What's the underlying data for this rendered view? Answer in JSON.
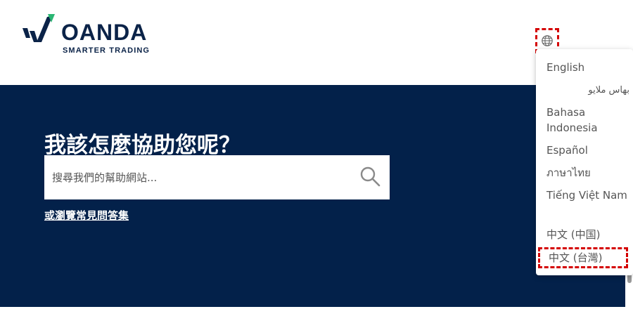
{
  "brand": {
    "name": "OANDA",
    "tagline": "SMARTER TRADING",
    "colors": {
      "navy": "#0b2348",
      "green": "#2bb673",
      "hero_bg": "#03214a"
    }
  },
  "header": {
    "language_button_icon": "globe-icon"
  },
  "hero": {
    "title": "我該怎麼協助您呢？",
    "search": {
      "placeholder": "搜尋我們的幫助網站...",
      "value": "",
      "icon": "search-icon"
    },
    "faq_link": "或瀏覽常見問答集"
  },
  "language_menu": {
    "items": [
      {
        "label": "English"
      },
      {
        "label": "بهاس ملايو"
      },
      {
        "label": "Bahasa Indonesia"
      },
      {
        "label": "Español"
      },
      {
        "label": "ภาษาไทย"
      },
      {
        "label": "Tiếng Việt Nam"
      },
      {
        "label": "中文 (中国)"
      },
      {
        "label": "中文 (台灣)"
      }
    ],
    "highlighted_color": "#d40000"
  }
}
